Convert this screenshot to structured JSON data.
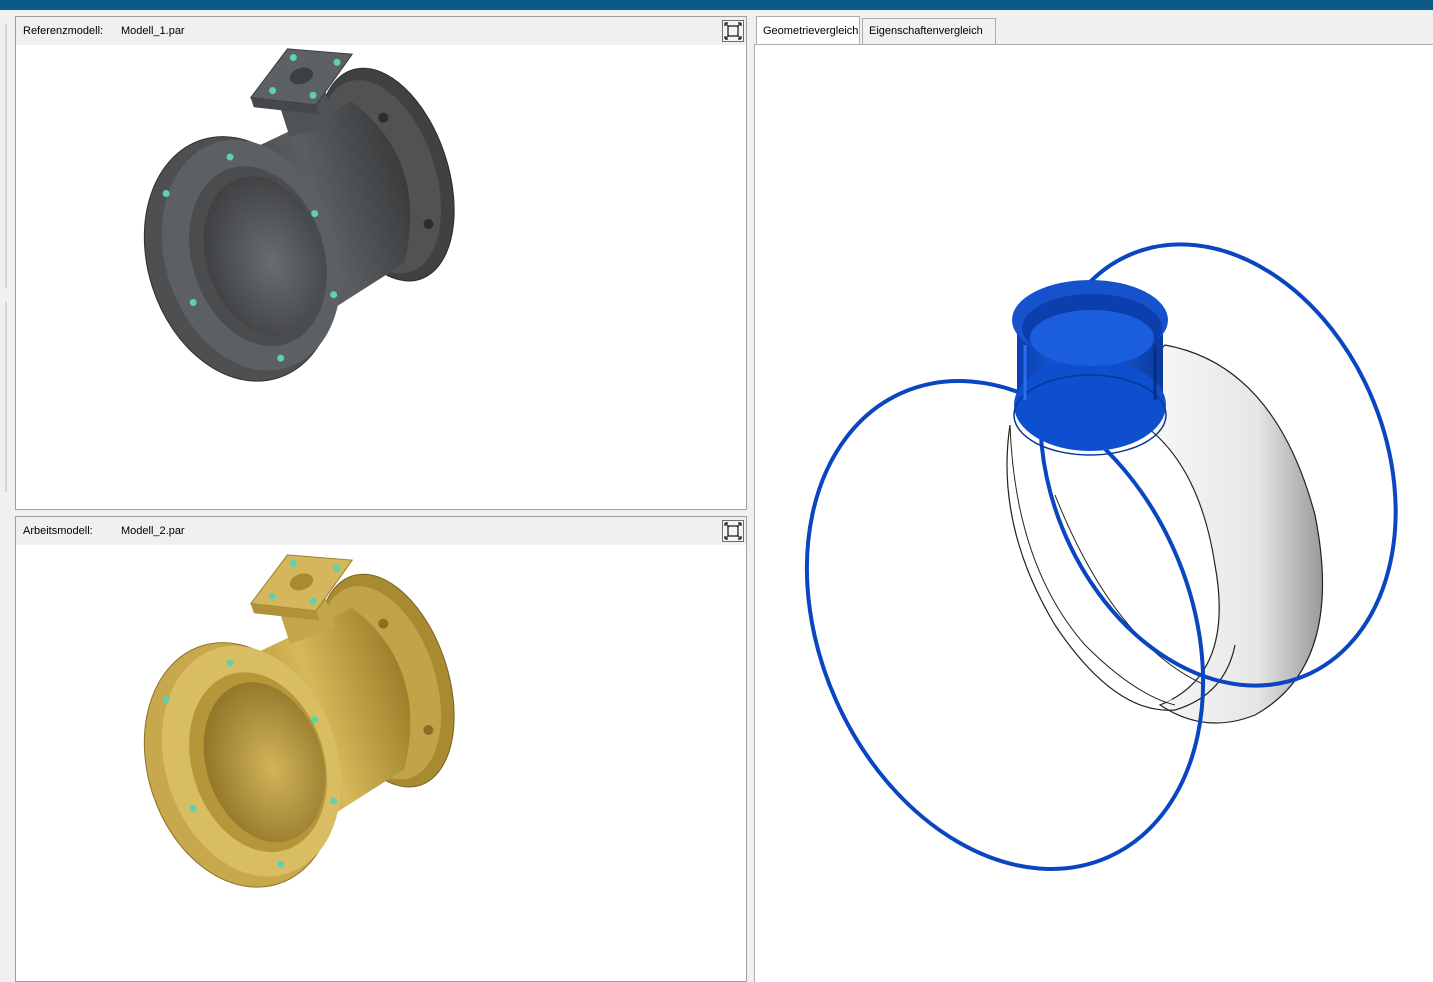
{
  "reference": {
    "label": "Referenzmodell:",
    "file": "Modell_1.par"
  },
  "working": {
    "label": "Arbeitsmodell:",
    "file": "Modell_2.par"
  },
  "tabs": [
    {
      "label": "Geometrievergleich",
      "active": true
    },
    {
      "label": "Eigenschaftenvergleich",
      "active": false
    }
  ],
  "colors": {
    "window_title": "#0e5a86",
    "reference_model": "#4a4c4e",
    "working_model": "#c8a84c",
    "diff_geometry": "#0a45c2",
    "hole_markers": "#5ed2b0"
  },
  "icons": {
    "maximize": "maximize-icon"
  }
}
